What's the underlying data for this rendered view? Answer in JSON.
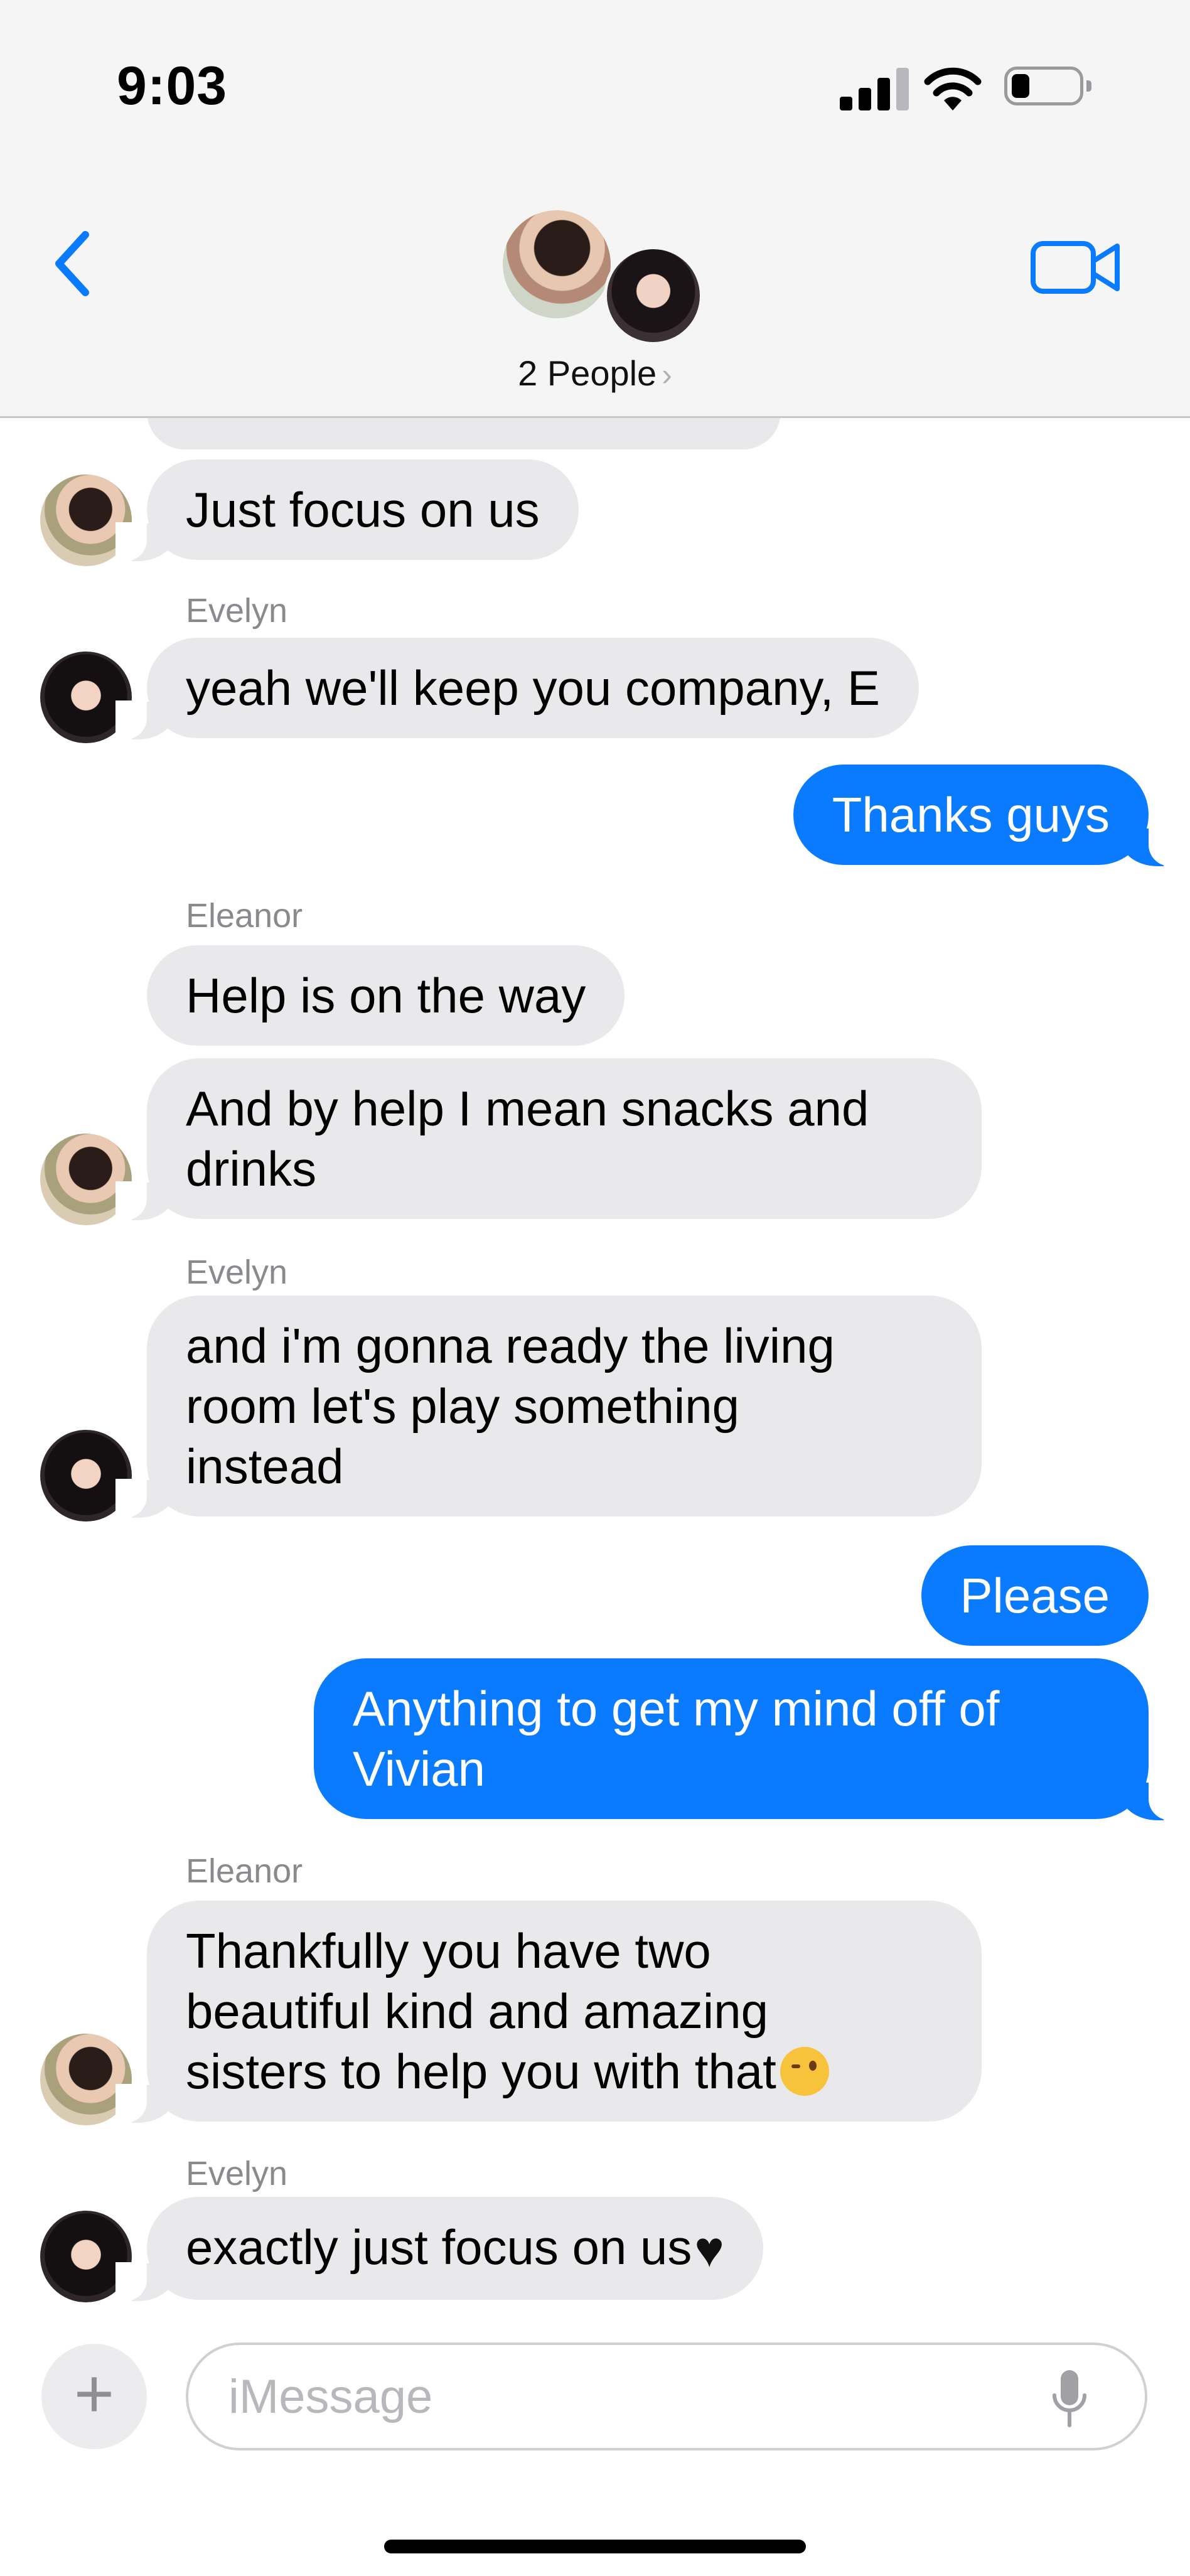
{
  "status_bar": {
    "time": "9:03",
    "signal_icon": "cellular-signal-icon",
    "wifi_icon": "wifi-icon",
    "battery_icon": "battery-icon",
    "battery_level": 0.25
  },
  "header": {
    "back_icon": "chevron-left-icon",
    "video_icon": "video-camera-icon",
    "people_label": "2 People",
    "people_chevron": "›",
    "accent_color": "#0a7aff"
  },
  "messages": [
    {
      "kind": "in",
      "text": "Just focus on us",
      "avatar": "eleanor"
    },
    {
      "kind": "in",
      "sender": "Evelyn",
      "text": "yeah we'll keep you company, E",
      "avatar": "evelyn"
    },
    {
      "kind": "out",
      "text": "Thanks guys"
    },
    {
      "kind": "in",
      "sender": "Eleanor",
      "text": "Help is on the way"
    },
    {
      "kind": "in",
      "lines": [
        "And by help I mean snacks and",
        "drinks"
      ],
      "avatar": "eleanor"
    },
    {
      "kind": "in",
      "sender": "Evelyn",
      "lines": [
        "and i'm gonna ready the living",
        "room let's play something",
        "instead"
      ],
      "avatar": "evelyn"
    },
    {
      "kind": "out",
      "text": "Please"
    },
    {
      "kind": "out",
      "lines": [
        "Anything to get my mind off of",
        "Vivian"
      ]
    },
    {
      "kind": "in",
      "sender": "Eleanor",
      "lines": [
        "Thankfully you have two",
        "beautiful kind and amazing",
        "sisters to help you with that"
      ],
      "emoji": "winking-face-emoji",
      "avatar": "eleanor"
    },
    {
      "kind": "in",
      "sender": "Evelyn",
      "text": "exactly just focus on us",
      "emoji": "black-heart-emoji",
      "avatar": "evelyn"
    }
  ],
  "composer": {
    "plus_label": "+",
    "placeholder": "iMessage",
    "mic_icon": "microphone-icon"
  },
  "colors": {
    "incoming_bubble": "#e9e9eb",
    "outgoing_bubble": "#0a7aff",
    "sender_name": "#8a8a8e"
  }
}
